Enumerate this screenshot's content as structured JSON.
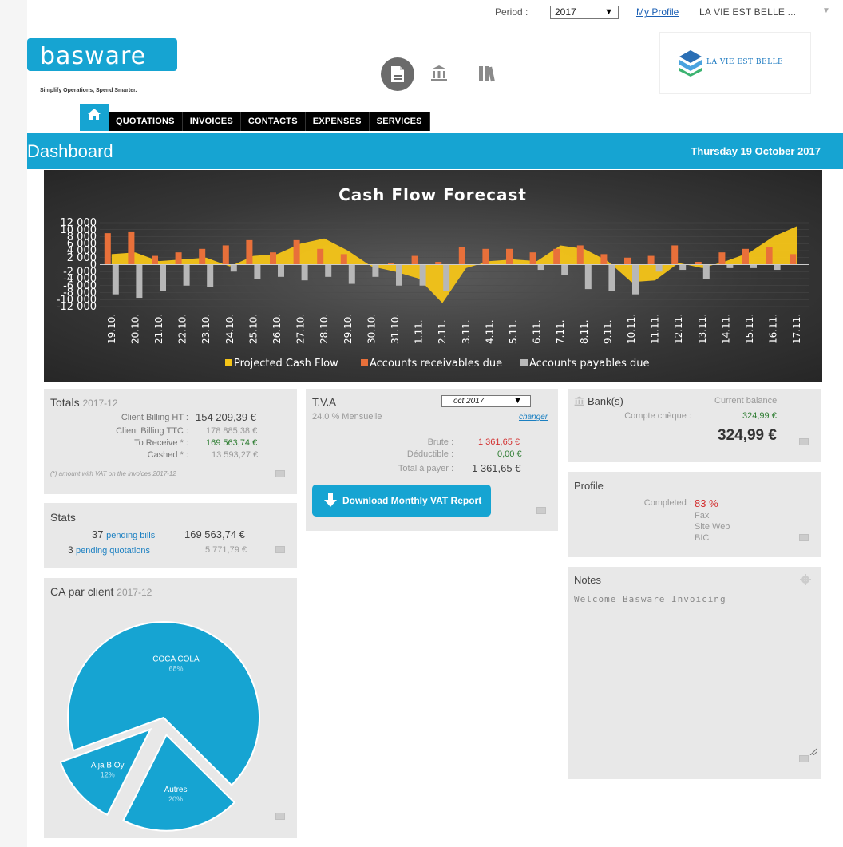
{
  "topbar": {
    "period_label": "Period :",
    "period_value": "2017",
    "my_profile": "My Profile",
    "company_name": "LA VIE EST BELLE ..."
  },
  "brand": {
    "logo": "basware",
    "tagline": "Simplify Operations, Spend Smarter.",
    "client_logo_text": "LA VIE EST BELLE"
  },
  "center_icons": [
    "document-icon",
    "bank-icon",
    "books-icon"
  ],
  "nav": {
    "home_icon": "home-icon",
    "tabs": [
      "QUOTATIONS",
      "INVOICES",
      "CONTACTS",
      "EXPENSES",
      "SERVICES"
    ]
  },
  "header": {
    "title": "Dashboard",
    "date": "Thursday 19 October 2017"
  },
  "chart_data": {
    "type": "bar",
    "title": "Cash Flow Forecast",
    "categories": [
      "19.10.",
      "20.10.",
      "21.10.",
      "22.10.",
      "23.10.",
      "24.10.",
      "25.10.",
      "26.10.",
      "27.10.",
      "28.10.",
      "29.10.",
      "30.10.",
      "31.10.",
      "1.11.",
      "2.11.",
      "3.11.",
      "4.11.",
      "5.11.",
      "6.11.",
      "7.11.",
      "8.11.",
      "9.11.",
      "10.11.",
      "11.11.",
      "12.11.",
      "13.11.",
      "14.11.",
      "15.11.",
      "16.11.",
      "17.11."
    ],
    "y_ticks": [
      "12 000",
      "10 000",
      "8 000",
      "6 000",
      "4 000",
      "2 000",
      "0",
      "-2 000",
      "-4 000",
      "-6 000",
      "-8 000",
      "-10 000",
      "-12 000"
    ],
    "ylim": [
      -12000,
      12000
    ],
    "series": [
      {
        "name": "Projected Cash Flow",
        "type": "area",
        "color": "#f5c518",
        "values": [
          3000,
          3500,
          1000,
          1500,
          2000,
          -500,
          2500,
          3000,
          6000,
          7500,
          4000,
          -500,
          -2000,
          -4000,
          -11000,
          -1000,
          1000,
          1500,
          1000,
          5500,
          4500,
          1000,
          -5000,
          -4500,
          500,
          -1000,
          1000,
          3500,
          8000,
          11000
        ]
      },
      {
        "name": "Accounts receivables due",
        "type": "bar",
        "color": "#e8703a",
        "values": [
          9000,
          9500,
          2500,
          3500,
          4500,
          5500,
          7000,
          3500,
          7000,
          4500,
          3000,
          0,
          500,
          2500,
          800,
          5000,
          4500,
          4500,
          3500,
          4500,
          5500,
          3000,
          2000,
          2500,
          5500,
          800,
          3500,
          4500,
          5000,
          3000
        ]
      },
      {
        "name": "Accounts payables due",
        "type": "bar",
        "color": "#b7b7b7",
        "values": [
          -8500,
          -9500,
          -7500,
          -6000,
          -6500,
          -2000,
          -4000,
          -3500,
          -4500,
          -3500,
          -5500,
          -3500,
          -6000,
          -6000,
          -7500,
          0,
          0,
          0,
          -1500,
          -3000,
          -7000,
          -7500,
          -8500,
          -2000,
          -1500,
          -4000,
          -1000,
          -1000,
          -1500,
          0
        ]
      }
    ]
  },
  "totals": {
    "title": "Totals",
    "period": "2017-12",
    "rows": [
      {
        "label": "Client Billing HT :",
        "value": "154 209,39 €"
      },
      {
        "label": "Client Billing TTC :",
        "value": "178 885,38 €"
      },
      {
        "label": "To Receive * :",
        "value": "169 563,74 €"
      },
      {
        "label": "Cashed * :",
        "value": "13 593,27 €"
      }
    ],
    "footnote": "(*) amount with VAT on the invoices 2017-12"
  },
  "stats": {
    "title": "Stats",
    "pending_bills_count": "37",
    "pending_bills_label": "pending bills",
    "pending_bills_value": "169 563,74 €",
    "pending_quotes_count": "3",
    "pending_quotes_label": "pending quotations",
    "pending_quotes_value": "5 771,79 €"
  },
  "ca_client": {
    "title": "CA par client",
    "period": "2017-12",
    "slices": [
      {
        "label": "COCA COLA",
        "pct": "68%",
        "value": 68
      },
      {
        "label": "Autres",
        "pct": "20%",
        "value": 20
      },
      {
        "label": "A ja B Oy",
        "pct": "12%",
        "value": 12
      }
    ],
    "color": "#16a4d2"
  },
  "tva": {
    "title": "T.V.A",
    "select_value": "oct 2017",
    "rate": "24.0 % Mensuelle",
    "change_link": "changer",
    "rows": [
      {
        "label": "Brute :",
        "value": "1 361,65 €"
      },
      {
        "label": "Déductible :",
        "value": "0,00 €"
      },
      {
        "label": "Total à payer :",
        "value": "1 361,65 €"
      }
    ],
    "download_button": "Download Monthly VAT Report"
  },
  "bank": {
    "title": "Bank(s)",
    "balance_header": "Current balance",
    "account_label": "Compte chèque :",
    "account_value": "324,99 €",
    "total": "324,99 €"
  },
  "profile": {
    "title": "Profile",
    "completed_label": "Completed :",
    "completed_value": "83 %",
    "missing": [
      "Fax",
      "Site Web",
      "BIC"
    ]
  },
  "notes": {
    "title": "Notes",
    "content": "Welcome Basware Invoicing"
  }
}
